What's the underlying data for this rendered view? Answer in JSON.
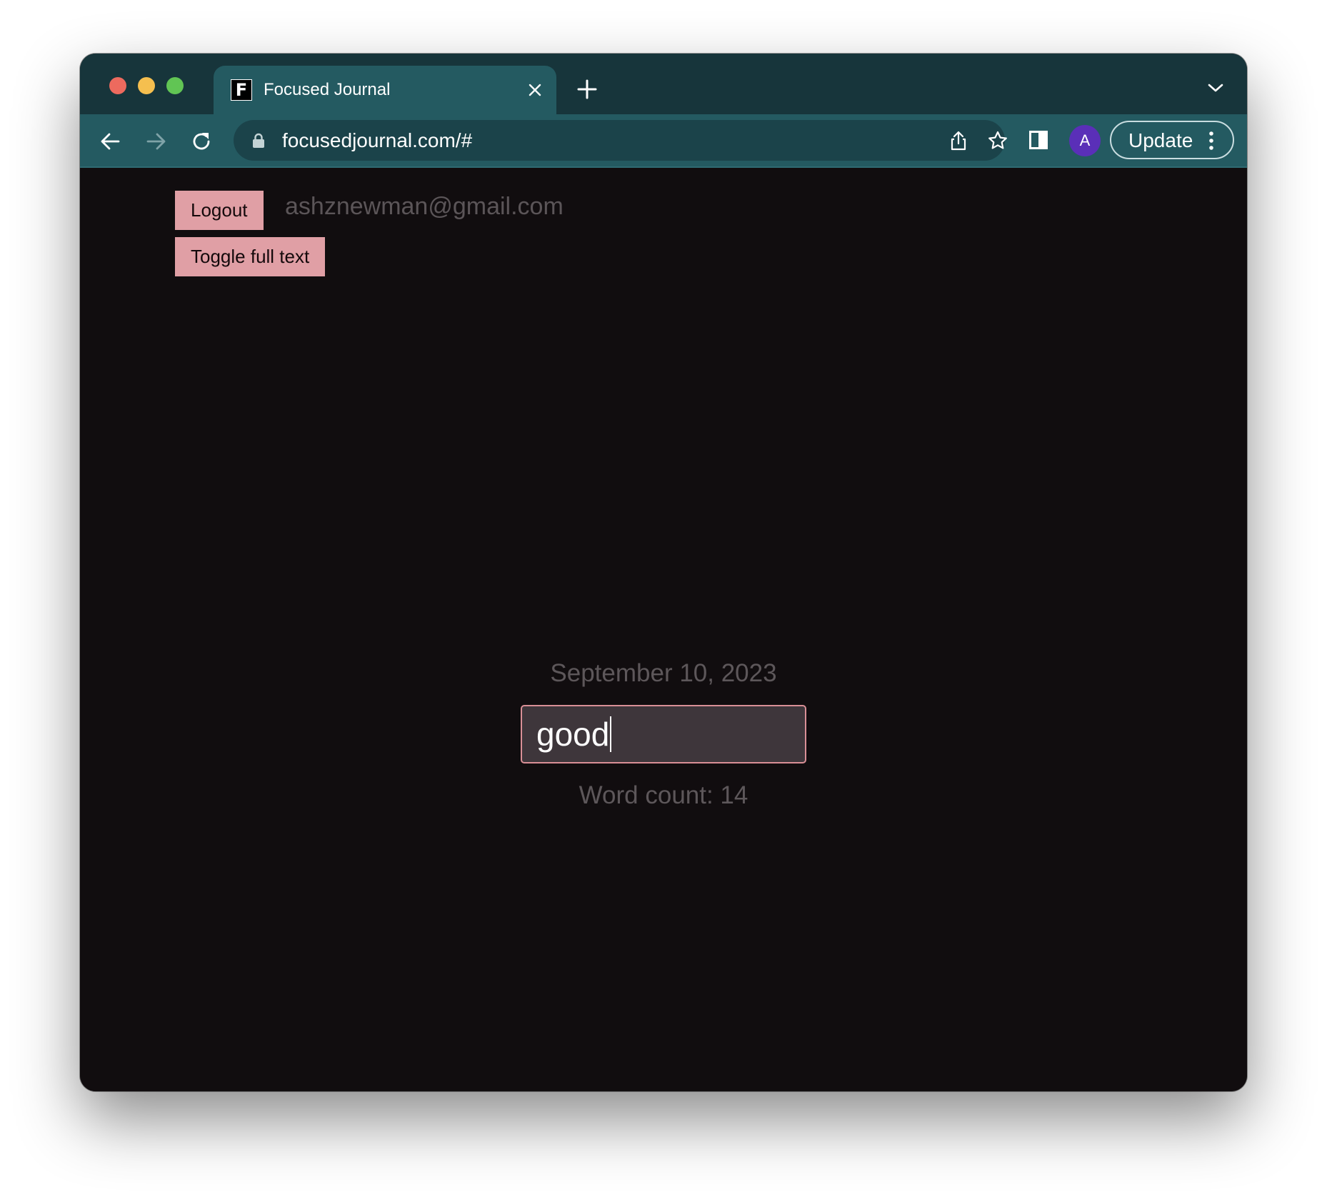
{
  "browser": {
    "tab_title": "Focused Journal",
    "favicon_letter": "F",
    "url": "focusedjournal.com/#",
    "avatar_letter": "A",
    "update_label": "Update"
  },
  "page": {
    "logout_label": "Logout",
    "toggle_label": "Toggle full text",
    "user_email": "ashznewman@gmail.com",
    "date": "September 10, 2023",
    "entry_value": "good",
    "word_count": "Word count: 14"
  },
  "colors": {
    "tab_strip": "#17353b",
    "toolbar": "#245a61",
    "page_background": "#110d0f",
    "button_accent": "#e09fa5",
    "input_border": "#d98f96",
    "avatar": "#5a2fb8"
  }
}
